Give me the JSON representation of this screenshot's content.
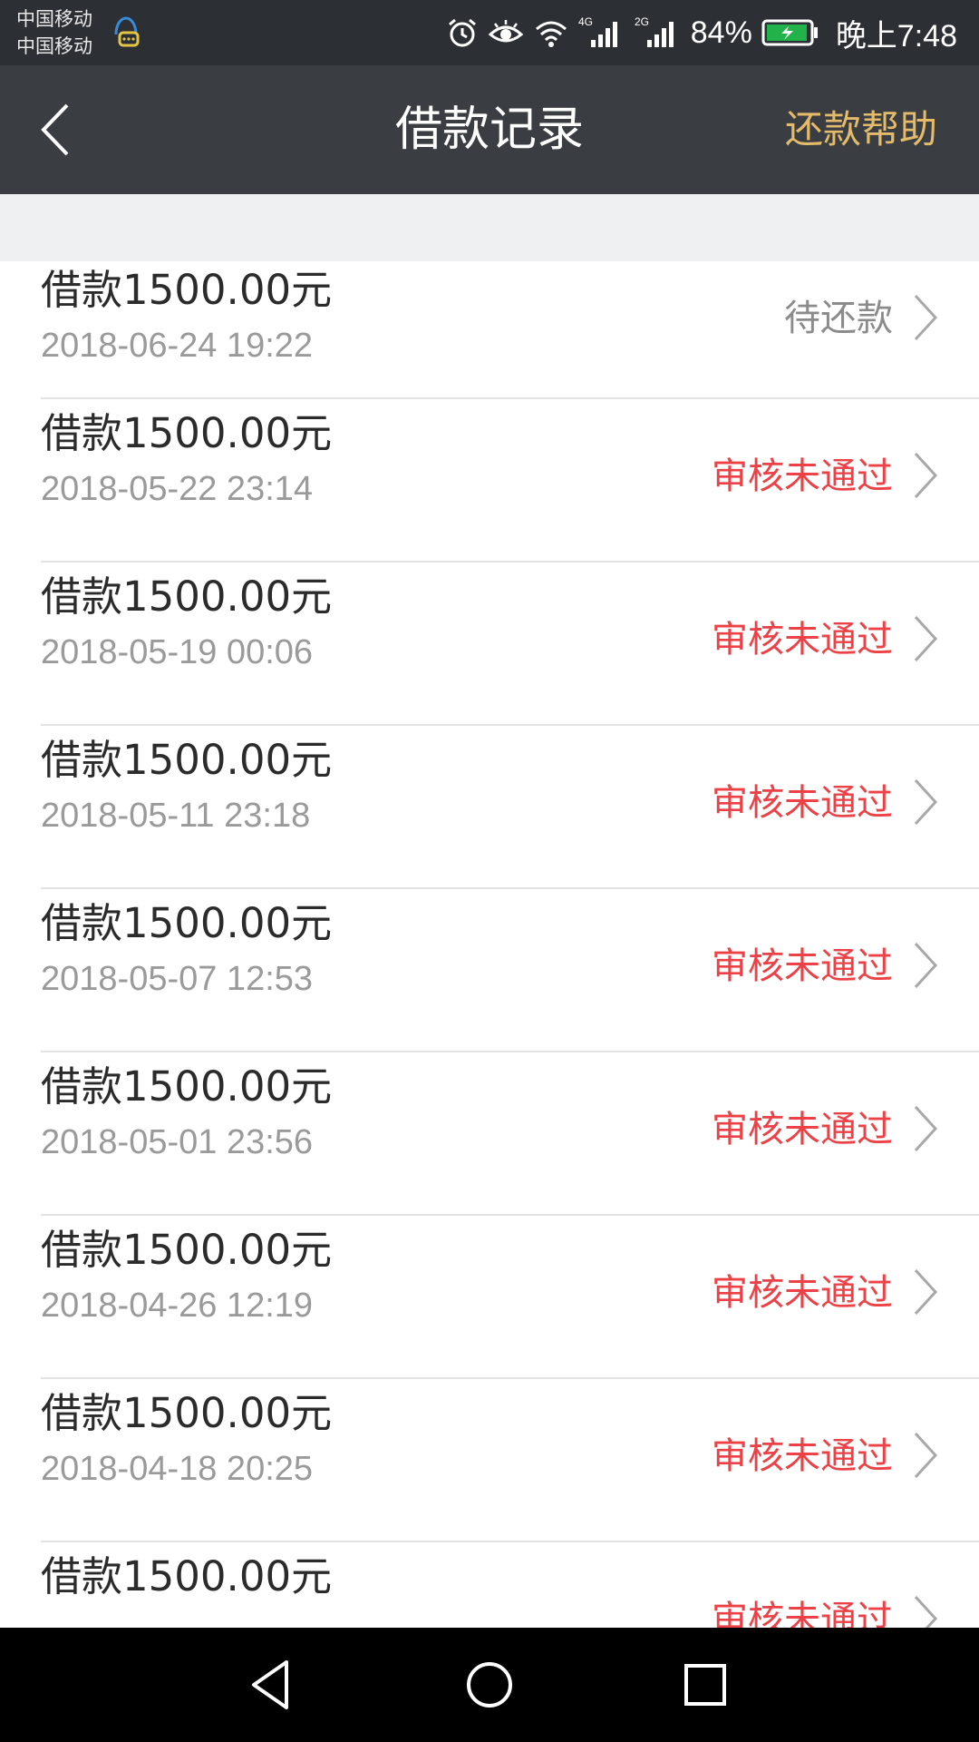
{
  "status_bar": {
    "carrier_1": "中国移动",
    "carrier_2": "中国移动",
    "network_1": "4G",
    "network_2": "2G",
    "battery": "84%",
    "time": "晚上7:48",
    "icons": [
      "notification-chat-icon",
      "alarm-icon",
      "eye-comfort-icon",
      "wifi-icon",
      "signal-icon",
      "battery-charging-icon"
    ],
    "battery_color": "#21b24a"
  },
  "header": {
    "title": "借款记录",
    "help_label": "还款帮助",
    "back_icon": "back-arrow-icon",
    "accent_color": "#e4bb6b"
  },
  "records": [
    {
      "amount": "借款1500.00元",
      "date": "2018-06-24 19:22",
      "status": "待还款",
      "status_type": "pending"
    },
    {
      "amount": "借款1500.00元",
      "date": "2018-05-22 23:14",
      "status": "审核未通过",
      "status_type": "rejected"
    },
    {
      "amount": "借款1500.00元",
      "date": "2018-05-19 00:06",
      "status": "审核未通过",
      "status_type": "rejected"
    },
    {
      "amount": "借款1500.00元",
      "date": "2018-05-11 23:18",
      "status": "审核未通过",
      "status_type": "rejected"
    },
    {
      "amount": "借款1500.00元",
      "date": "2018-05-07 12:53",
      "status": "审核未通过",
      "status_type": "rejected"
    },
    {
      "amount": "借款1500.00元",
      "date": "2018-05-01 23:56",
      "status": "审核未通过",
      "status_type": "rejected"
    },
    {
      "amount": "借款1500.00元",
      "date": "2018-04-26 12:19",
      "status": "审核未通过",
      "status_type": "rejected"
    },
    {
      "amount": "借款1500.00元",
      "date": "2018-04-18 20:25",
      "status": "审核未通过",
      "status_type": "rejected"
    },
    {
      "amount": "借款1500.00元",
      "date": "",
      "status": "审核未通过",
      "status_type": "rejected"
    }
  ],
  "status_colors": {
    "pending": "#8b8b8b",
    "rejected": "#ec4146"
  },
  "nav_bar": {
    "buttons": [
      "nav-back-triangle-icon",
      "nav-home-circle-icon",
      "nav-recent-square-icon"
    ]
  }
}
